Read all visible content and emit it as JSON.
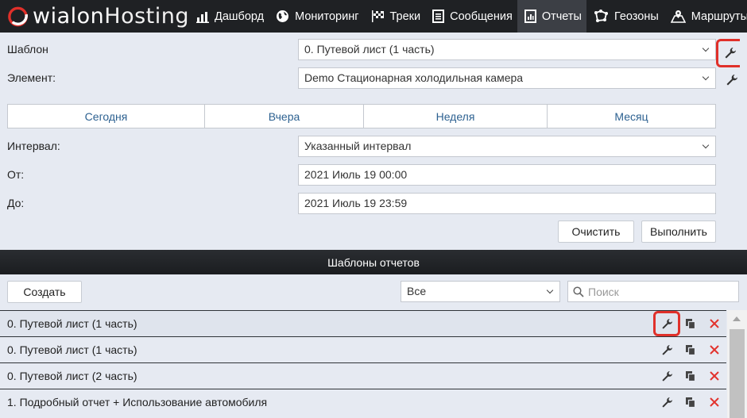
{
  "app": {
    "logo_main": "wialon",
    "logo_sub": "Hosting"
  },
  "nav": [
    {
      "label": "Дашборд",
      "icon": "chart-icon",
      "active": false
    },
    {
      "label": "Мониторинг",
      "icon": "globe-icon",
      "active": false
    },
    {
      "label": "Треки",
      "icon": "checkered-flag-icon",
      "active": false
    },
    {
      "label": "Сообщения",
      "icon": "document-icon",
      "active": false
    },
    {
      "label": "Отчеты",
      "icon": "report-icon",
      "active": true
    },
    {
      "label": "Геозоны",
      "icon": "polygon-icon",
      "active": false
    },
    {
      "label": "Маршруты",
      "icon": "map-icon",
      "active": false
    }
  ],
  "form": {
    "template_label": "Шаблон",
    "template_value": "0. Путевой лист (1 часть)",
    "element_label": "Элемент:",
    "element_value": "Demo Стационарная холодильная камера",
    "interval_label": "Интервал:",
    "interval_value": "Указанный интервал",
    "from_label": "От:",
    "from_value": "2021 Июль 19 00:00",
    "to_label": "До:",
    "to_value": "2021 Июль 19 23:59",
    "clear_label": "Очистить",
    "run_label": "Выполнить"
  },
  "period_tabs": [
    "Сегодня",
    "Вчера",
    "Неделя",
    "Месяц"
  ],
  "templates": {
    "header": "Шаблоны отчетов",
    "create_label": "Создать",
    "filter_value": "Все",
    "search_placeholder": "Поиск",
    "rows": [
      {
        "name": "0. Путевой лист (1 часть)"
      },
      {
        "name": "0. Путевой лист (1 часть)"
      },
      {
        "name": "0. Путевой лист (2 часть)"
      },
      {
        "name": "1. Подробный отчет + Использование автомобиля"
      }
    ]
  },
  "colors": {
    "topbar": "#1f2124",
    "accent_link": "#2d6191",
    "highlight": "#e0302a",
    "delete": "#e2332d"
  }
}
